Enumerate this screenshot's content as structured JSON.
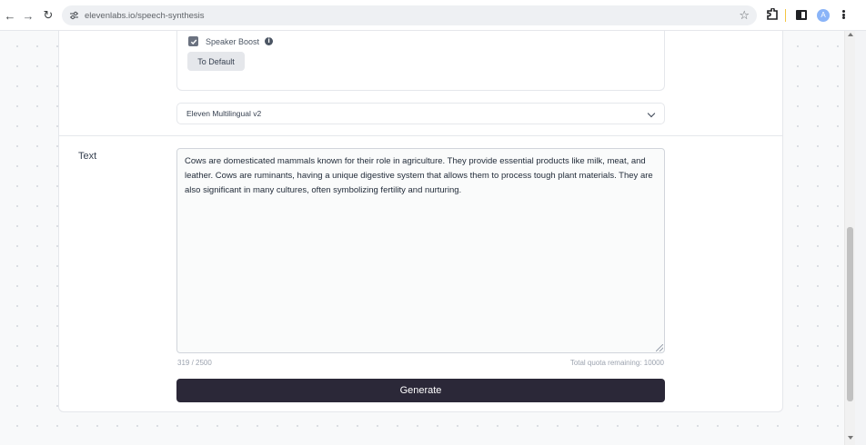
{
  "browser": {
    "url": "elevenlabs.io/speech-synthesis",
    "avatar_letter": "A"
  },
  "settings": {
    "speaker_boost_label": "Speaker Boost",
    "speaker_boost_checked": true,
    "to_default_label": "To Default",
    "model_selected": "Eleven Multilingual v2"
  },
  "text_section": {
    "label": "Text",
    "content": "Cows are domesticated mammals known for their role in agriculture. They provide essential products like milk, meat, and leather. Cows are ruminants, having a unique digestive system that allows them to process tough plant materials. They are also significant in many cultures, often symbolizing fertility and nurturing.",
    "char_count": "319 / 2500",
    "quota": "Total quota remaining: 10000",
    "generate_label": "Generate"
  },
  "colors": {
    "accent": "#2b2838",
    "border": "#e5e7eb"
  }
}
